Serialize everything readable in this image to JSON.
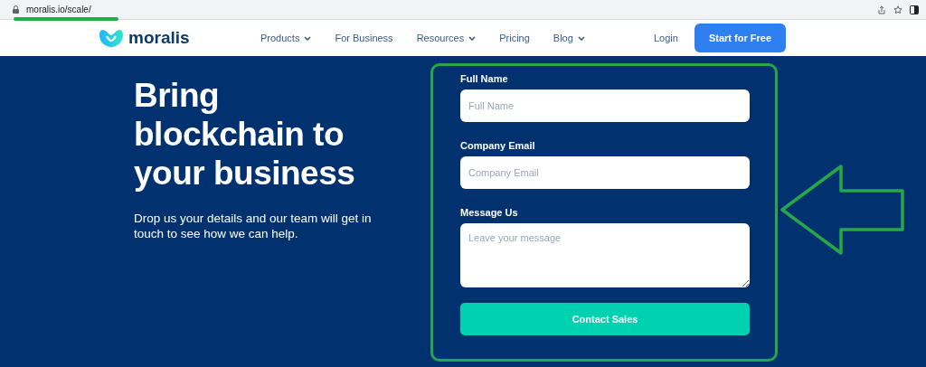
{
  "browser": {
    "url": "moralis.io/scale/"
  },
  "nav": {
    "logo": "moralis",
    "items": [
      {
        "label": "Products",
        "has_menu": true
      },
      {
        "label": "For Business",
        "has_menu": false
      },
      {
        "label": "Resources",
        "has_menu": true
      },
      {
        "label": "Pricing",
        "has_menu": false
      },
      {
        "label": "Blog",
        "has_menu": true
      }
    ],
    "login": "Login",
    "cta": "Start for Free"
  },
  "hero": {
    "title_lines": [
      "Bring",
      "blockchain to",
      "your business"
    ],
    "text": "Drop us your details and our team will get in touch to see how we can help."
  },
  "form": {
    "fields": [
      {
        "kind": "input",
        "label": "Full Name",
        "placeholder": "Full Name"
      },
      {
        "kind": "input",
        "label": "Company Email",
        "placeholder": "Company Email"
      },
      {
        "kind": "textarea",
        "label": "Message Us",
        "placeholder": "Leave your message"
      }
    ],
    "submit": "Contact Sales"
  }
}
